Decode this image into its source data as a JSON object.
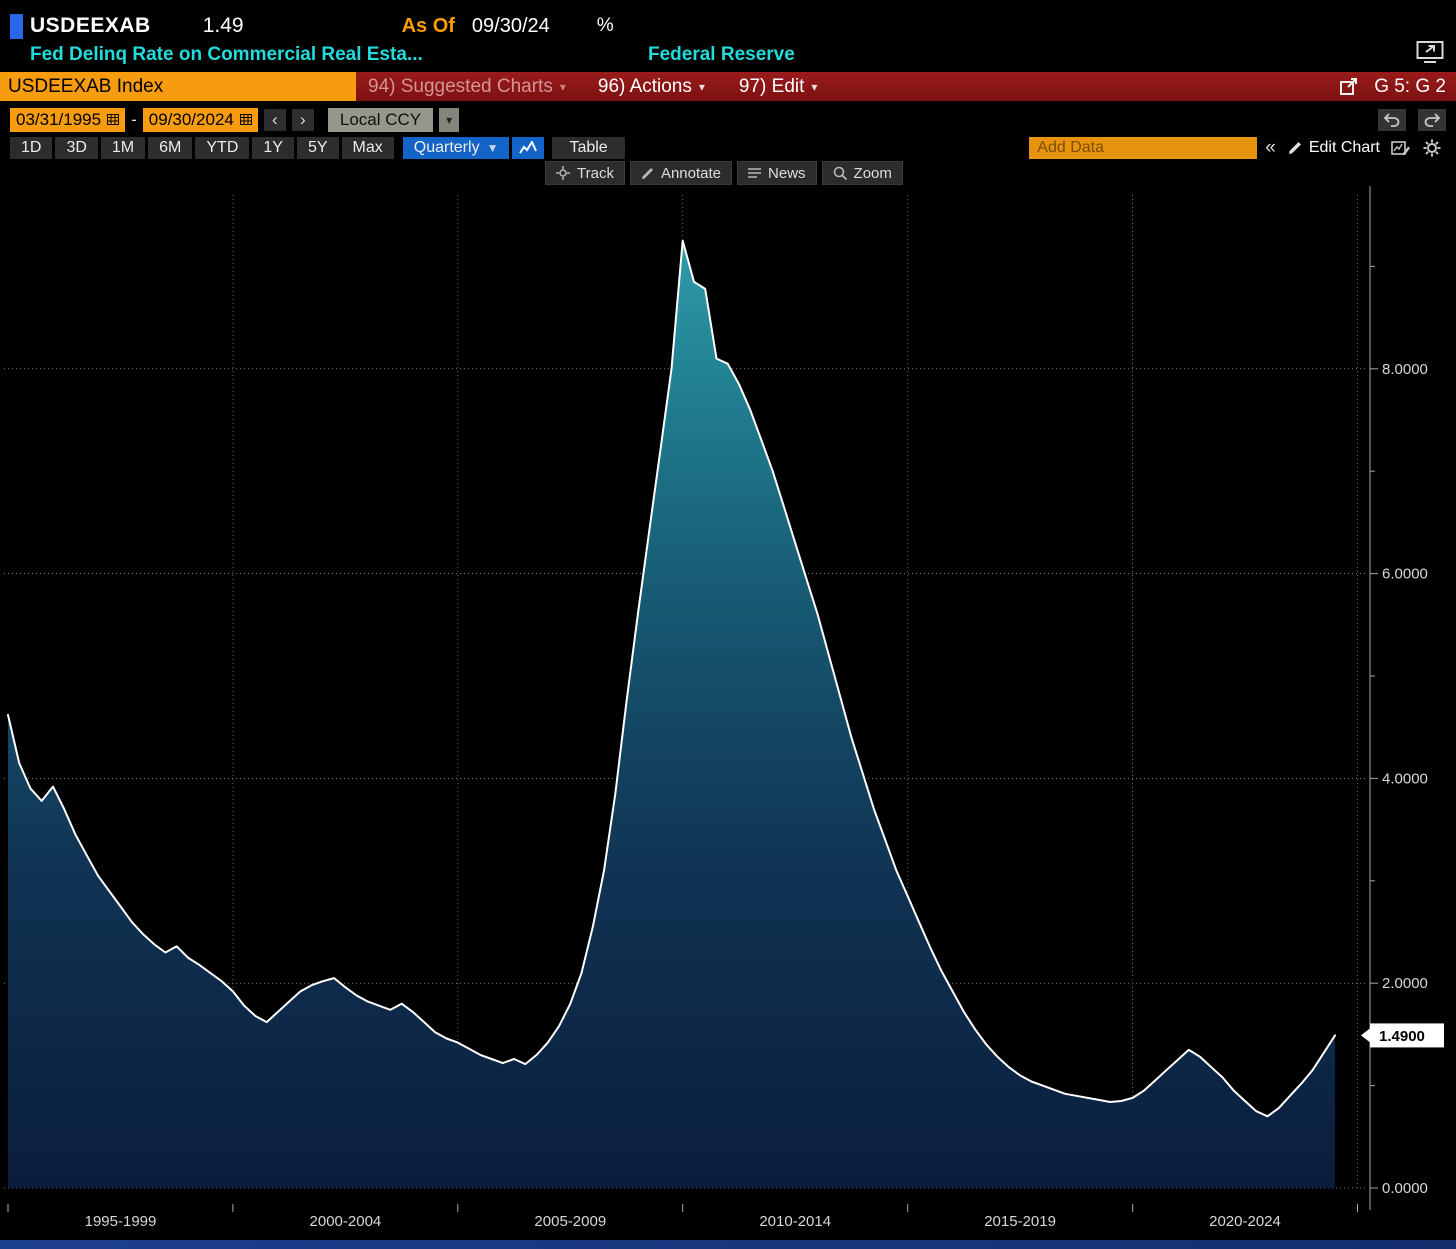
{
  "top_bar": {
    "ticker": "USDEEXAB",
    "last_value": "1.49",
    "as_of_label": "As Of",
    "as_of_date": "09/30/24",
    "unit": "%"
  },
  "title_bar": {
    "description": "Fed Delinq Rate on Commercial Real Esta...",
    "source": "Federal Reserve"
  },
  "menu_bar": {
    "security_field": "USDEEXAB Index",
    "suggested_charts_label": "94) Suggested Charts",
    "actions_label": "96) Actions",
    "edit_label": "97) Edit",
    "grid_indicator": "G 5: G 2"
  },
  "range_bar": {
    "start_date": "03/31/1995",
    "separator": "-",
    "end_date": "09/30/2024",
    "currency_selector": "Local CCY"
  },
  "period_bar": {
    "tabs": [
      "1D",
      "3D",
      "1M",
      "6M",
      "YTD",
      "1Y",
      "5Y",
      "Max"
    ],
    "frequency_selector": "Quarterly",
    "table_button": "Table",
    "add_data_placeholder": "Add Data",
    "edit_chart_button": "Edit Chart"
  },
  "chart_toolbar": {
    "track": "Track",
    "annotate": "Annotate",
    "news": "News",
    "zoom": "Zoom"
  },
  "icons": {
    "caret_down": "▾",
    "caret_down_solid": "▼",
    "prev": "‹",
    "next": "›",
    "collapse": "«"
  },
  "colors": {
    "amber": "#f79b0f",
    "cyan": "#22dbdb",
    "menu_red": "#8c1515",
    "accent_blue": "#1463c8",
    "area_top": "#38a2b5",
    "area_bottom": "#0b1d3d",
    "line": "#ffffff"
  },
  "chart_data": {
    "type": "area",
    "title": "Fed Delinq Rate on Commercial Real Estate (USDEEXAB Index)",
    "source": "Federal Reserve",
    "frequency": "quarterly",
    "start_period": "1995-Q1",
    "end_period": "2024-Q3",
    "ylim": [
      0,
      9.65
    ],
    "grid": true,
    "y_ticks": [
      0,
      2,
      4,
      6,
      8
    ],
    "y_tick_labels": [
      "0.0000",
      "2.0000",
      "4.0000",
      "6.0000",
      "8.0000"
    ],
    "x_labels": [
      "1995-1999",
      "2000-2004",
      "2005-2009",
      "2010-2014",
      "2015-2019",
      "2020-2024"
    ],
    "last_value": 1.49,
    "last_value_label": "1.4900",
    "values": [
      4.62,
      4.15,
      3.9,
      3.78,
      3.92,
      3.7,
      3.45,
      3.25,
      3.05,
      2.9,
      2.75,
      2.6,
      2.48,
      2.38,
      2.3,
      2.36,
      2.25,
      2.18,
      2.1,
      2.02,
      1.92,
      1.78,
      1.68,
      1.62,
      1.72,
      1.82,
      1.92,
      1.98,
      2.02,
      2.05,
      1.96,
      1.88,
      1.82,
      1.78,
      1.74,
      1.8,
      1.72,
      1.62,
      1.52,
      1.46,
      1.42,
      1.36,
      1.3,
      1.26,
      1.22,
      1.26,
      1.21,
      1.3,
      1.42,
      1.58,
      1.8,
      2.1,
      2.55,
      3.1,
      3.85,
      4.75,
      5.6,
      6.4,
      7.2,
      8.0,
      9.25,
      8.85,
      8.78,
      8.1,
      8.05,
      7.85,
      7.6,
      7.3,
      7.0,
      6.65,
      6.3,
      5.95,
      5.6,
      5.2,
      4.8,
      4.4,
      4.05,
      3.7,
      3.4,
      3.1,
      2.85,
      2.6,
      2.35,
      2.12,
      1.92,
      1.72,
      1.55,
      1.4,
      1.28,
      1.18,
      1.1,
      1.04,
      1.0,
      0.96,
      0.92,
      0.9,
      0.88,
      0.86,
      0.84,
      0.85,
      0.88,
      0.95,
      1.05,
      1.15,
      1.25,
      1.35,
      1.28,
      1.18,
      1.08,
      0.95,
      0.85,
      0.75,
      0.7,
      0.78,
      0.9,
      1.02,
      1.15,
      1.32,
      1.49
    ]
  }
}
